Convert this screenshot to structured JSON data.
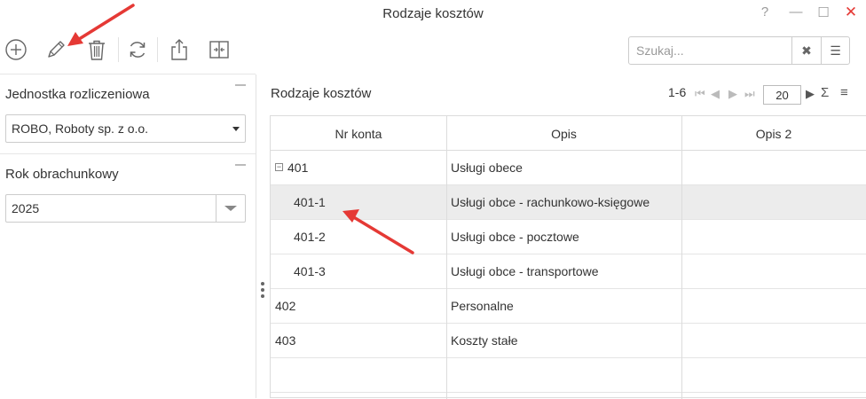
{
  "window": {
    "title": "Rodzaje kosztów",
    "help_label": "?",
    "minimize_label": "—",
    "maximize_label": "☐",
    "close_label": "✕"
  },
  "toolbar": {
    "buttons": [
      {
        "name": "add",
        "icon": "plus-circle-icon"
      },
      {
        "name": "edit",
        "icon": "pencil-icon"
      },
      {
        "name": "delete",
        "icon": "trash-icon"
      },
      {
        "name": "refresh",
        "icon": "refresh-icon"
      },
      {
        "name": "export",
        "icon": "share-upload-icon"
      },
      {
        "name": "split",
        "icon": "split-columns-icon"
      }
    ],
    "search_placeholder": "Szukaj...",
    "search_value": "",
    "clear_label": "✖",
    "menu_label": "☰"
  },
  "left_panel": {
    "unit": {
      "title": "Jednostka rozliczeniowa",
      "value": "ROBO, Roboty sp. z o.o."
    },
    "year": {
      "title": "Rok obrachunkowy",
      "value": "2025"
    }
  },
  "grid": {
    "title": "Rodzaje kosztów",
    "pager": {
      "range": "1-6",
      "page_size": "20"
    },
    "columns": [
      "Nr konta",
      "Opis",
      "Opis 2"
    ],
    "rows": [
      {
        "nr": "401",
        "opis": "Usługi obece",
        "opis2": "",
        "expander": "−",
        "selected": false
      },
      {
        "nr": "401-1",
        "opis": "Usługi obce - rachunkowo-księgowe",
        "opis2": "",
        "selected": true
      },
      {
        "nr": "401-2",
        "opis": "Usługi obce - pocztowe",
        "opis2": "",
        "selected": false
      },
      {
        "nr": "401-3",
        "opis": "Usługi obce - transportowe",
        "opis2": "",
        "selected": false
      },
      {
        "nr": "402",
        "opis": "Personalne",
        "opis2": "",
        "selected": false
      },
      {
        "nr": "403",
        "opis": "Koszty stałe",
        "opis2": "",
        "selected": false
      }
    ]
  },
  "colors": {
    "accent_red": "#e53935",
    "selected_row": "#ececec",
    "border": "#dcdcdc"
  }
}
